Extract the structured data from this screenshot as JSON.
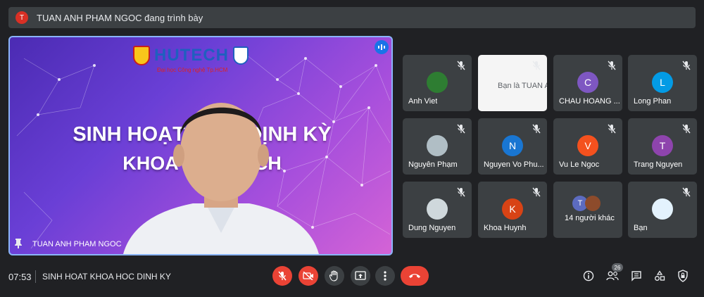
{
  "banner": {
    "avatar_letter": "T",
    "text": "TUAN ANH PHAM NGOC đang trình bày"
  },
  "presentation": {
    "logo_word": "HUTECH",
    "logo_sub": "Đại học Công nghệ Tp.HCM",
    "title_line1": "SINH HOẠT K      OC ĐỊNH KỲ",
    "title_line2": "KHOA DU       UTECH",
    "presenter_name": "TUAN ANH PHAM NGOC"
  },
  "participants": [
    {
      "name": "Anh Viet",
      "letter": "",
      "color": "#2e7d32"
    },
    {
      "name": "Bạn là TUAN A...",
      "letter": "",
      "color": "#ffffff"
    },
    {
      "name": "CHAU HOANG ...",
      "letter": "C",
      "color": "#7e57c2"
    },
    {
      "name": "Long Phan",
      "letter": "L",
      "color": "#039be5"
    },
    {
      "name": "Nguyên Phạm",
      "letter": "",
      "color": "#b0bec5"
    },
    {
      "name": "Nguyen Vo Phu...",
      "letter": "N",
      "color": "#1976d2"
    },
    {
      "name": "Vu Le Ngoc",
      "letter": "V",
      "color": "#f4511e"
    },
    {
      "name": "Trang Nguyen",
      "letter": "T",
      "color": "#8e44ad"
    },
    {
      "name": "Dung Nguyen",
      "letter": "",
      "color": "#cfd8dc"
    },
    {
      "name": "Khoa Huynh",
      "letter": "K",
      "color": "#d84315"
    },
    {
      "name": "14 người khác",
      "letter": "T",
      "color": "#5c6bc0"
    },
    {
      "name": "Bạn",
      "letter": "",
      "color": "#e3f2fd"
    }
  ],
  "footer": {
    "time": "07:53",
    "meeting_title": "SINH HOAT KHOA HOC DINH KY",
    "people_count": "26"
  },
  "colors": {
    "accent": "#8ab4f8",
    "danger": "#ea4335",
    "tile": "#3c4043",
    "bg": "#202124"
  }
}
